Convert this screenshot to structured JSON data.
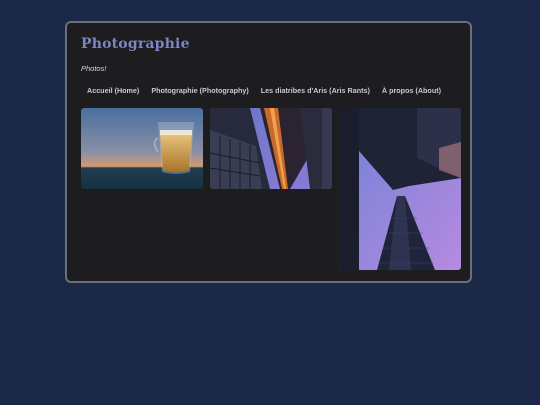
{
  "site": {
    "title": "Photographie",
    "tagline": "Photos!"
  },
  "nav": {
    "items": [
      {
        "label": "Accueil (Home)"
      },
      {
        "label": "Photographie (Photography)"
      },
      {
        "label": "Les diatribes d'Aris (Aris Rants)"
      },
      {
        "label": "À propos (About)"
      }
    ]
  },
  "gallery": {
    "photos": [
      {
        "subject": "glass of beer at sunset",
        "icon": "photo-beer"
      },
      {
        "subject": "looking up between buildings",
        "icon": "photo-buildings"
      },
      {
        "subject": "skyscraper from below",
        "icon": "photo-skyscraper"
      }
    ]
  },
  "colors": {
    "page_background": "#1c2847",
    "card_background": "#1d1d1f",
    "title_accent": "#7b86c4"
  }
}
